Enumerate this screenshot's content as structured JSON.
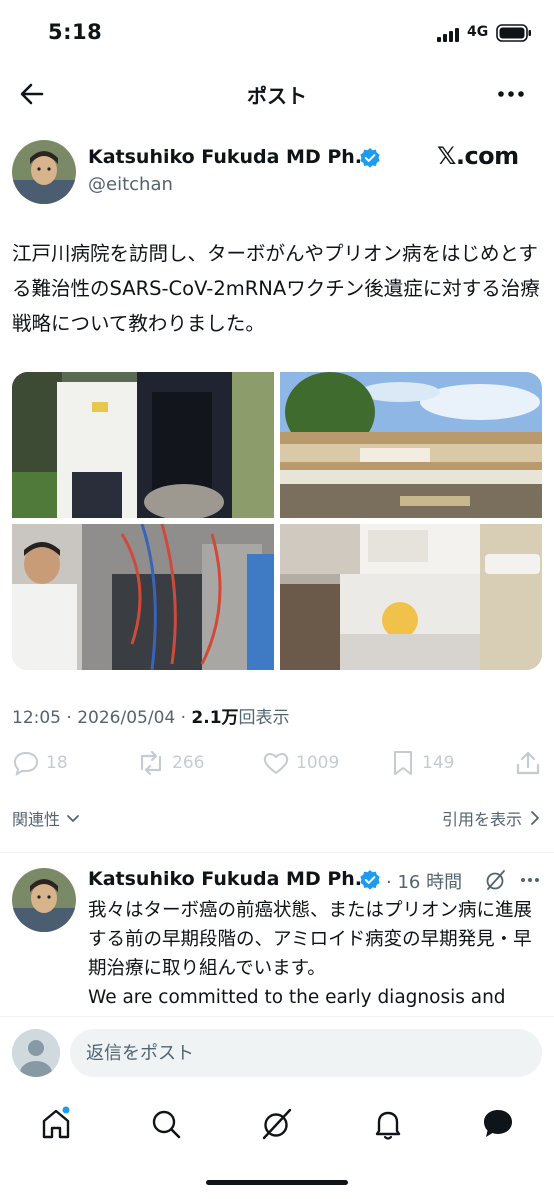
{
  "status_bar": {
    "time": "5:18",
    "network": "4G"
  },
  "header": {
    "title": "ポスト"
  },
  "post": {
    "author_name": "Katsuhiko Fukuda MD Ph...",
    "handle": "@eitchan",
    "source_mark": "𝕏.com",
    "text": "江戸川病院を訪問し、ターボがんやプリオン病をはじめとする難治性のSARS-CoV-2mRNAワクチン後遺症に対する治療戦略について教わりました。",
    "time": "12:05",
    "date": "2026/05/04",
    "views_count": "2.1万",
    "views_label": "回表示",
    "stats": {
      "replies": "18",
      "reposts": "266",
      "likes": "1009",
      "bookmarks": "149"
    }
  },
  "sort": {
    "label": "関連性",
    "quotes_label": "引用を表示"
  },
  "reply": {
    "author_name": "Katsuhiko Fukuda MD Ph...",
    "time": "16 時間",
    "text_ja": "我々はターボ癌の前癌状態、またはプリオン病に進展する前の早期段階の、アミロイド病変の早期発見・早期治療に取り組んでいます。",
    "text_en": "We are committed to the early diagnosis and treatment of amyloid pathologies in the"
  },
  "compose": {
    "placeholder": "返信をポスト"
  },
  "colors": {
    "verified": "#1d9bf0",
    "muted": "#536471",
    "action": "#c4ccd3"
  }
}
